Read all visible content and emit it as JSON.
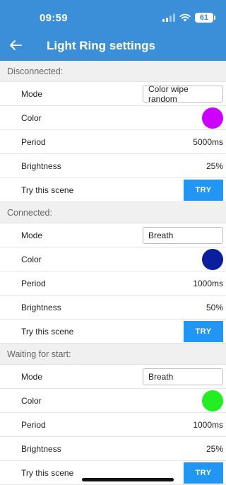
{
  "status": {
    "time": "09:59",
    "battery": "61"
  },
  "header": {
    "title": "Light Ring settings"
  },
  "sections": [
    {
      "title": "Disconnected:",
      "mode_label": "Mode",
      "mode_value": "Color wipe random",
      "color_label": "Color",
      "color_hex": "#cc00ff",
      "period_label": "Period",
      "period_value": "5000ms",
      "brightness_label": "Brightness",
      "brightness_value": "25%",
      "try_label": "Try this scene",
      "try_button": "TRY"
    },
    {
      "title": "Connected:",
      "mode_label": "Mode",
      "mode_value": "Breath",
      "color_label": "Color",
      "color_hex": "#0a1f9e",
      "period_label": "Period",
      "period_value": "1000ms",
      "brightness_label": "Brightness",
      "brightness_value": "50%",
      "try_label": "Try this scene",
      "try_button": "TRY"
    },
    {
      "title": "Waiting for start:",
      "mode_label": "Mode",
      "mode_value": "Breath",
      "color_label": "Color",
      "color_hex": "#22ee22",
      "period_label": "Period",
      "period_value": "1000ms",
      "brightness_label": "Brightness",
      "brightness_value": "25%",
      "try_label": "Try this scene",
      "try_button": "TRY"
    }
  ],
  "colors": {
    "app_bar": "#3b8fd9",
    "accent": "#2196f3"
  },
  "icons": {
    "back": "back-arrow-icon",
    "signal": "cellular-signal-icon",
    "wifi": "wifi-icon",
    "battery": "battery-icon"
  }
}
